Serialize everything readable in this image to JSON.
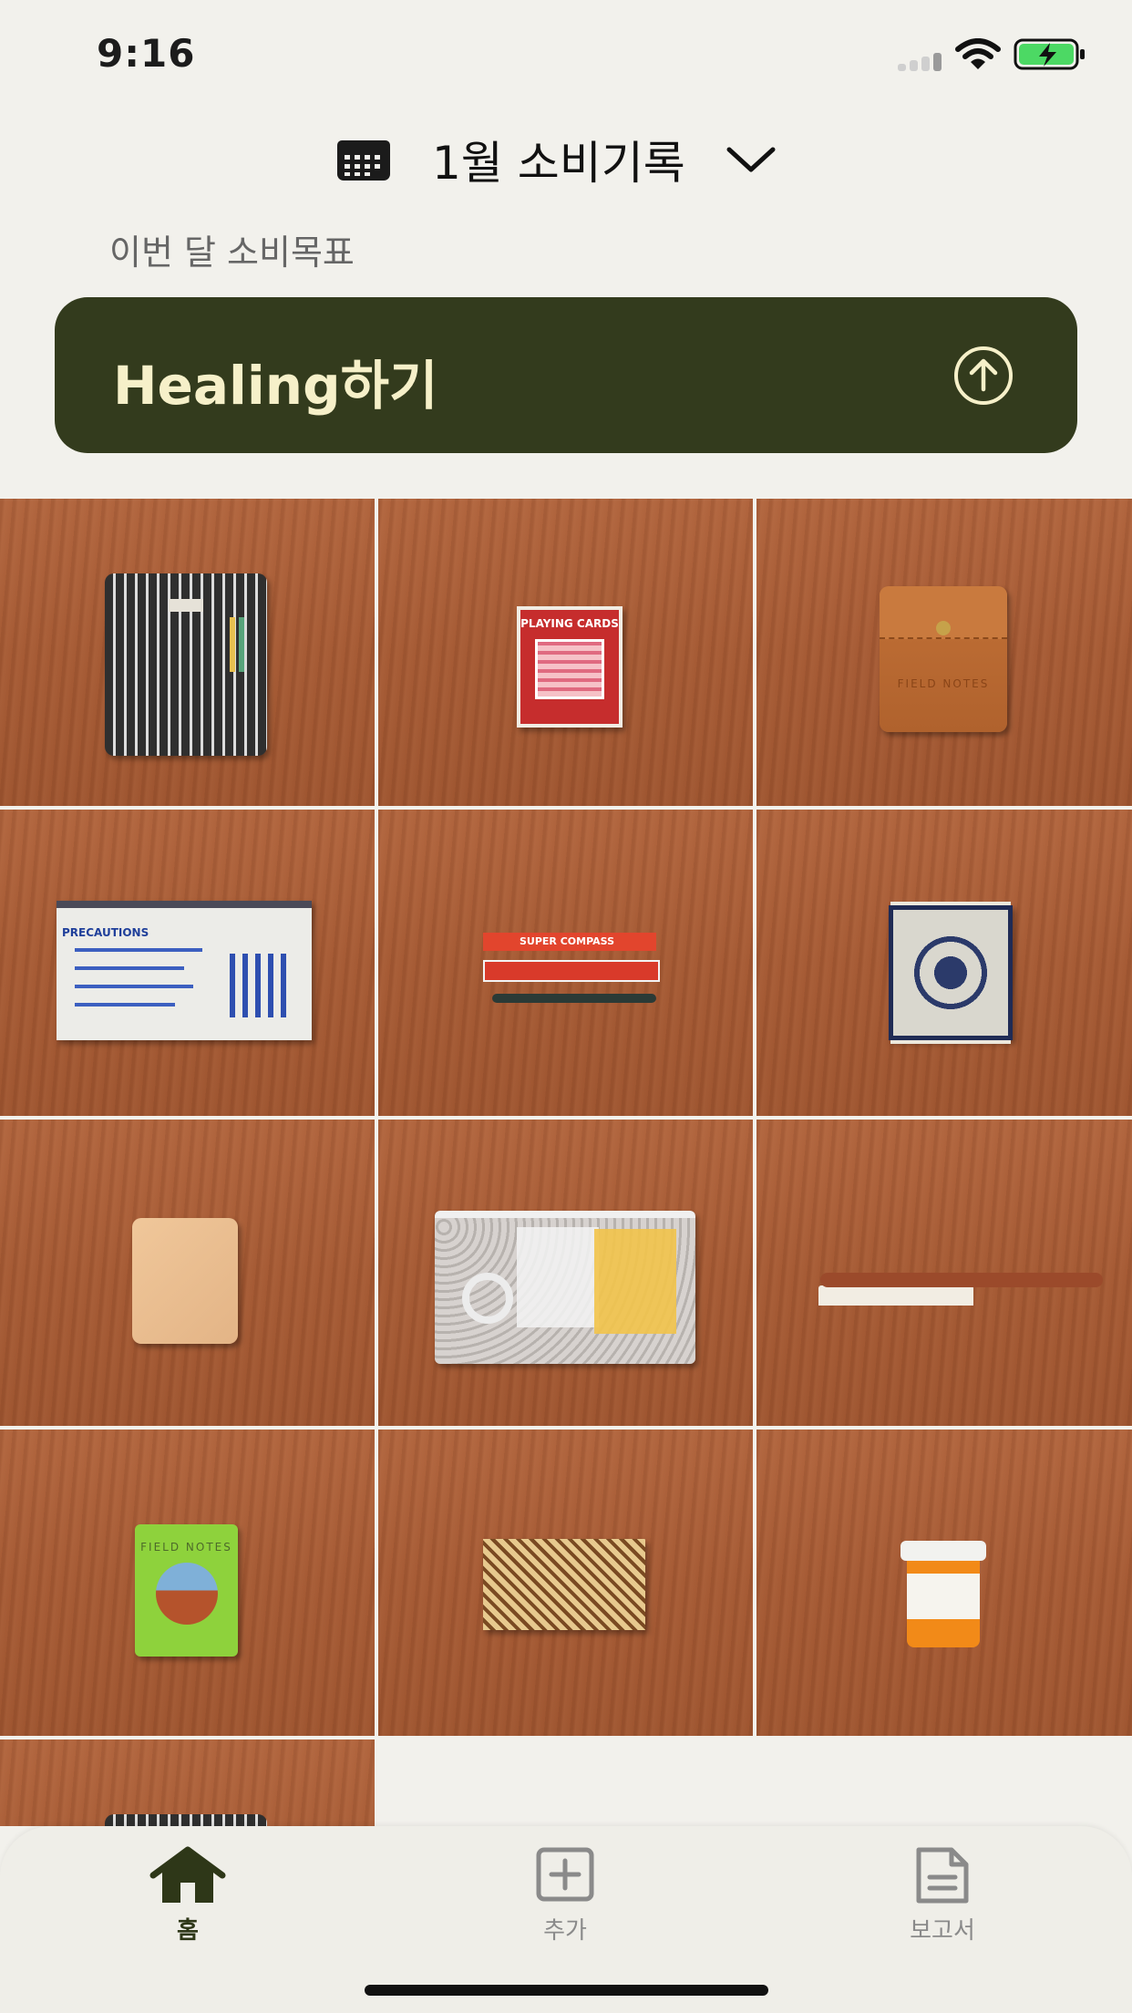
{
  "status_bar": {
    "time": "9:16"
  },
  "header": {
    "title": "1월 소비기록"
  },
  "goal": {
    "label": "이번 달 소비목표",
    "text": "Healing하기"
  },
  "grid_items": [
    {
      "name": "striped-pen-case",
      "text": ""
    },
    {
      "name": "playing-cards",
      "text": "PLAYING CARDS"
    },
    {
      "name": "leather-pouch",
      "text": "FIELD NOTES"
    },
    {
      "name": "cement-bag-pouch",
      "text": "PRECAUTIONS"
    },
    {
      "name": "compass-and-knife",
      "text": "SUPER COMPASS"
    },
    {
      "name": "mini-rug",
      "text": ""
    },
    {
      "name": "leather-notebook",
      "text": ""
    },
    {
      "name": "clear-zip-bag",
      "text": ""
    },
    {
      "name": "brush",
      "text": ""
    },
    {
      "name": "field-notes-notebook",
      "text": "FIELD NOTES"
    },
    {
      "name": "puzzle-box",
      "text": ""
    },
    {
      "name": "pill-bottle",
      "text": ""
    },
    {
      "name": "striped-pen-case-2",
      "text": ""
    }
  ],
  "tab_bar": {
    "tabs": [
      {
        "label": "홈",
        "icon": "home-icon",
        "active": true
      },
      {
        "label": "추가",
        "icon": "add-icon",
        "active": false
      },
      {
        "label": "보고서",
        "icon": "report-icon",
        "active": false
      }
    ]
  },
  "colors": {
    "background": "#f2f1ec",
    "goal_card": "#333b1d",
    "goal_text": "#f6f0c9",
    "active_tab": "#2e3718",
    "inactive_tab": "#8a8a8a"
  }
}
